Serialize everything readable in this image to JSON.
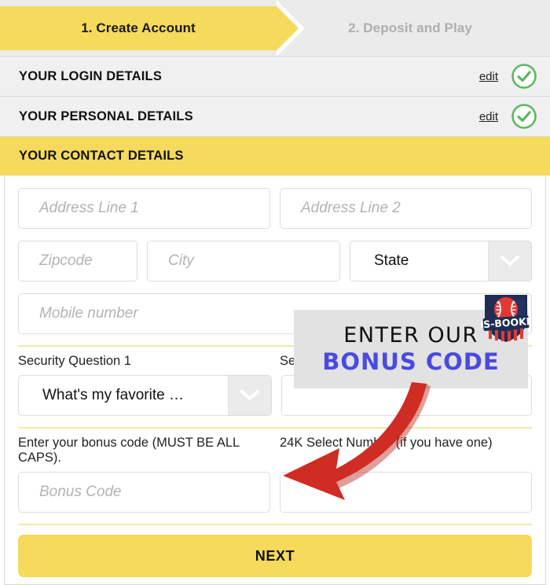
{
  "steps": {
    "active": {
      "label": "1. Create Account"
    },
    "inactive": {
      "label": "2. Deposit and Play"
    }
  },
  "accordion": [
    {
      "title": "YOUR LOGIN DETAILS",
      "edit_label": "edit",
      "status_icon": "check-circle-icon"
    },
    {
      "title": "YOUR PERSONAL DETAILS",
      "edit_label": "edit",
      "status_icon": "check-circle-icon"
    }
  ],
  "contact_section": {
    "title": "YOUR CONTACT DETAILS",
    "address_line_1_placeholder": "Address Line 1",
    "address_line_2_placeholder": "Address Line 2",
    "zipcode_placeholder": "Zipcode",
    "city_placeholder": "City",
    "state_value": "State",
    "state_caret_icon": "chevron-down-icon",
    "mobile_placeholder": "Mobile number",
    "security_q1_label": "Security Question 1",
    "security_q1_value": "What's my favorite …",
    "security_q1_caret_icon": "chevron-down-icon",
    "security_q2_label": "Security Question 2",
    "security_q2_placeholder": "",
    "bonus_code_label": "Enter your bonus code (MUST BE ALL CAPS).",
    "bonus_code_placeholder": "Bonus Code",
    "select_number_label": "24K Select Number (if you have one)",
    "select_number_placeholder": ""
  },
  "next_button": {
    "label": "NEXT"
  },
  "promo": {
    "line1": "ENTER OUR",
    "line2": "BONUS CODE",
    "logo_text": "US-BOOKIE",
    "logo_icon": "shield-baseball-logo-icon",
    "arrow_icon": "curved-arrow-icon"
  },
  "colors": {
    "brand_yellow": "#f5da5c",
    "banner_grey": "#ebebeb",
    "check_green": "#5cb85c",
    "promo_blue": "#4a4ae0",
    "arrow_red": "#cf2c23",
    "logo_navy": "#1f2d54",
    "logo_red": "#e03a32"
  }
}
